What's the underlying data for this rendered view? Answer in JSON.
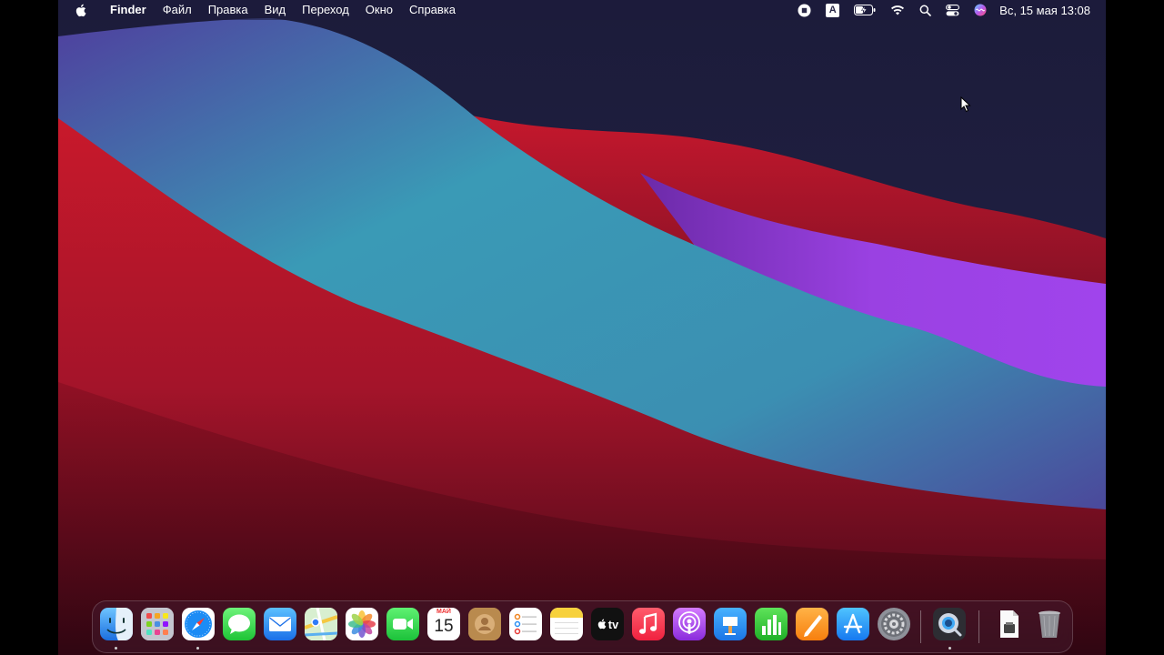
{
  "menubar": {
    "app_name": "Finder",
    "items": [
      "Файл",
      "Правка",
      "Вид",
      "Переход",
      "Окно",
      "Справка"
    ],
    "status_icons": [
      "screen-record-icon",
      "keyboard-layout-icon",
      "battery-charging-icon",
      "wifi-icon",
      "spotlight-search-icon",
      "control-center-icon",
      "siri-icon"
    ],
    "keyboard_layout_letter": "A",
    "clock": "Вс, 15 мая  13:08"
  },
  "dock": {
    "apps": [
      "finder",
      "launchpad",
      "safari",
      "messages",
      "mail",
      "maps",
      "photos",
      "facetime",
      "calendar",
      "contacts",
      "reminders",
      "notes",
      "apple-tv",
      "music",
      "podcasts",
      "keynote",
      "numbers",
      "pages",
      "app-store",
      "system-preferences",
      "quicktime-player",
      "document",
      "trash"
    ],
    "calendar_month": "МАЙ",
    "calendar_day": "15",
    "tv_label": "tv"
  },
  "colors": {
    "wallpaper_navy": "#222044",
    "wallpaper_red": "#c11a2b",
    "wallpaper_cyan": "#3aa2b8",
    "wallpaper_purple": "#9a3fe0",
    "wallpaper_indigo": "#5a3e9c"
  }
}
